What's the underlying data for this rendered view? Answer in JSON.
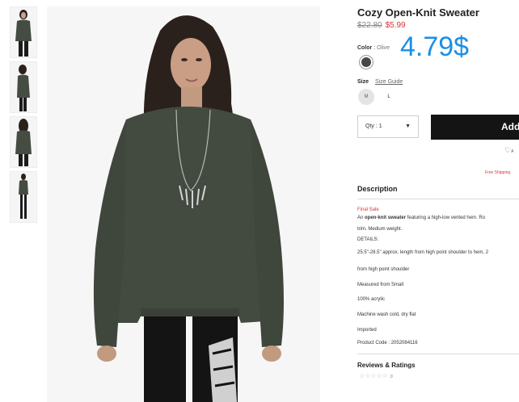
{
  "product": {
    "title": "Cozy Open-Knit Sweater",
    "old_price": "$22.80",
    "sale_price": "$5.99",
    "overlay_price": "4.79$",
    "color_label": "Color",
    "color_value": "Olive",
    "size_label": "Size",
    "size_guide": "Size Guide",
    "sizes": [
      "M",
      "L"
    ],
    "qty_label": "Qty : 1",
    "add_button": "Add",
    "wishlist_label": "A",
    "free_shipping": "Free Shipping"
  },
  "description": {
    "heading": "Description",
    "final_sale": "Final Sale",
    "intro_prefix": "An ",
    "intro_bold": "open-knit sweater",
    "intro_rest": " featuring a high-low vented hem. Ro",
    "intro_line2": "trim. Medium weight.",
    "details_label": "DETAILS:",
    "details": [
      "25.5\"-28.5\" approx. length from high point shoulder to hem, 2",
      "from high point shoulder",
      "Measured from Small",
      "100% acrylic",
      "Machine wash cold, dry flat",
      "Imported",
      "Product Code : 2052084116"
    ]
  },
  "reviews": {
    "heading": "Reviews & Ratings",
    "stars": "☆☆☆☆☆",
    "count": "0"
  },
  "colors": {
    "sale": "#d9343a",
    "overlay": "#1b8fe6",
    "button": "#141414",
    "sweater": "#434a40"
  }
}
